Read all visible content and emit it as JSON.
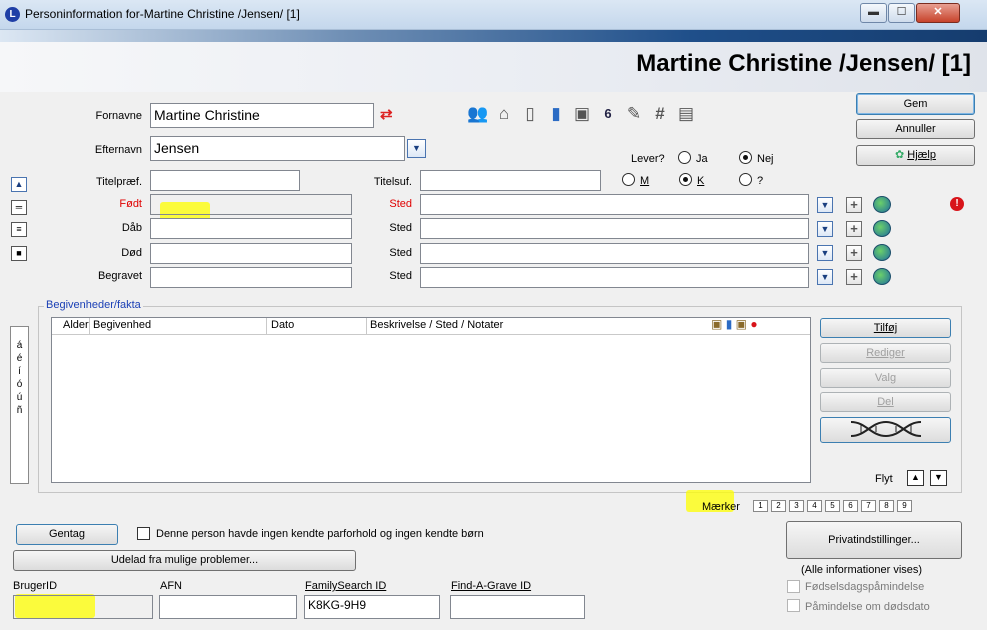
{
  "window": {
    "title": "Personinformation for-Martine Christine /Jensen/ [1]",
    "app_icon": "L",
    "min": "▬",
    "max": "☐",
    "close": "✕"
  },
  "header": {
    "person_name": "Martine Christine /Jensen/ [1]"
  },
  "names": {
    "fornavne_label": "Fornavne",
    "fornavne_value": "Martine Christine",
    "efternavn_label": "Efternavn",
    "efternavn_value": "Jensen",
    "titelpraef_label": "Titelpræf.",
    "titelpraef_value": "",
    "titelsuf_label": "Titelsuf.",
    "titelsuf_value": ""
  },
  "toolbar_icons": [
    "people-icon",
    "home-icon",
    "note-icon",
    "books-icon",
    "photo-icon",
    "calendar-icon",
    "pen-icon",
    "hash-icon",
    "reference-icon"
  ],
  "lever": {
    "label": "Lever?",
    "ja": "Ja",
    "nej": "Nej",
    "selected": "Nej"
  },
  "sex": {
    "m": "M",
    "k": "K",
    "unknown": "?",
    "selected": "K"
  },
  "buttons": {
    "gem": "Gem",
    "annuller": "Annuller",
    "hjaelp": "Hjælp",
    "tilfoej": "Tilføj",
    "rediger": "Rediger",
    "valg": "Valg",
    "del": "Del",
    "dna": "DNA",
    "gentag": "Gentag",
    "udelad": "Udelad fra mulige problemer...",
    "privat": "Privatindstillinger..."
  },
  "events": [
    {
      "label": "Født",
      "sted_label": "Sted",
      "date": "",
      "place": "",
      "red": true
    },
    {
      "label": "Dåb",
      "sted_label": "Sted",
      "date": "",
      "place": "",
      "red": false
    },
    {
      "label": "Død",
      "sted_label": "Sted",
      "date": "",
      "place": "",
      "red": false
    },
    {
      "label": "Begravet",
      "sted_label": "Sted",
      "date": "",
      "place": "",
      "red": false
    }
  ],
  "nav_buttons": [
    "▲",
    "═",
    "≡",
    "■"
  ],
  "begivenheder": {
    "title": "Begivenheder/fakta",
    "columns": [
      "Alder",
      "Begivenhed",
      "Dato",
      "Beskrivelse / Sted / Notater"
    ],
    "rows": [],
    "flyt_label": "Flyt"
  },
  "chars": [
    "á",
    "é",
    "í",
    "ó",
    "ú",
    "ñ"
  ],
  "maerker": {
    "label": "Mærker",
    "boxes": [
      "1",
      "2",
      "3",
      "4",
      "5",
      "6",
      "7",
      "8",
      "9"
    ]
  },
  "no_partner": {
    "label": "Denne person havde ingen kendte parforhold og ingen kendte børn",
    "checked": false
  },
  "ids": {
    "brugerid_label": "BrugerID",
    "brugerid_value": "",
    "afn_label": "AFN",
    "afn_value": "",
    "familysearch_label": "FamilySearch ID",
    "familysearch_value": "K8KG-9H9",
    "findagrave_label": "Find-A-Grave ID",
    "findagrave_value": ""
  },
  "privacy": {
    "status": "(Alle informationer vises)",
    "birthday_reminder": "Fødselsdagspåmindelse",
    "death_reminder": "Påmindelse om dødsdato"
  },
  "colors": {
    "accent": "#1f4f8a",
    "required_label": "#e00000",
    "highlight": "#ffff00"
  }
}
